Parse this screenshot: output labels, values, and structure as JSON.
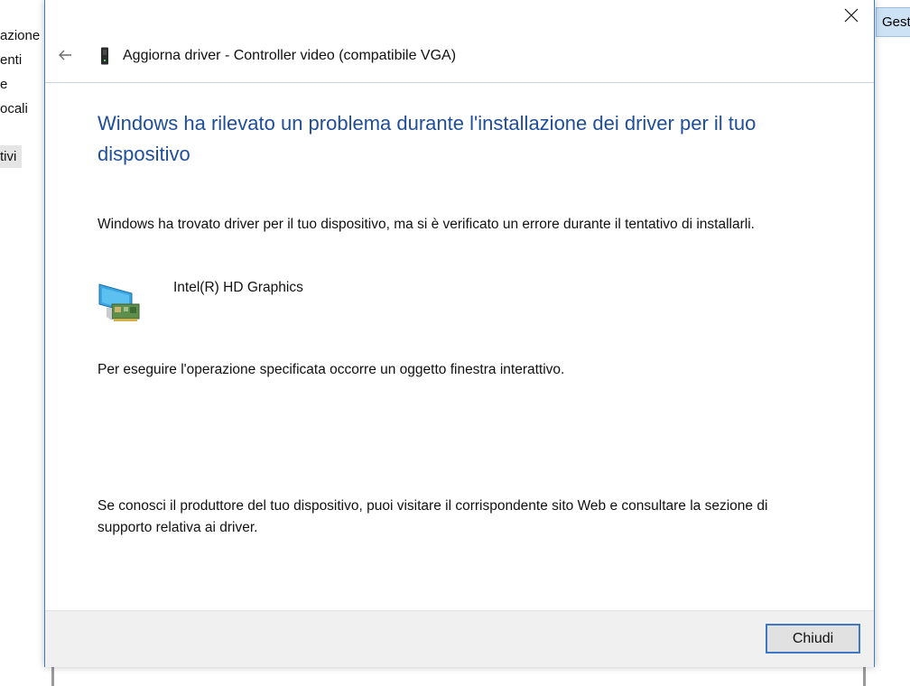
{
  "background": {
    "left_items": [
      "azione",
      "enti",
      "e",
      "ocali",
      "tivi"
    ],
    "right_button_label": "Gest"
  },
  "dialog": {
    "header_title": "Aggiorna driver - Controller video (compatibile VGA)",
    "heading": "Windows ha rilevato un problema durante l'installazione dei driver per il tuo dispositivo",
    "message": "Windows ha trovato driver per il tuo dispositivo, ma si è verificato un errore durante il tentativo di installarli.",
    "device_name": "Intel(R) HD Graphics",
    "error_detail": "Per eseguire l'operazione specificata occorre un oggetto finestra interattivo.",
    "support_note": "Se conosci il produttore del tuo dispositivo, puoi visitare il corrispondente sito Web e consultare la sezione di supporto relativa ai driver.",
    "close_button_label": "Chiudi"
  },
  "icons": {
    "close": "close-icon",
    "back": "back-arrow-icon",
    "device": "device-icon",
    "display_adapter": "display-adapter-icon"
  },
  "colors": {
    "heading": "#1f4e9a",
    "accent_border": "#3c78c3",
    "footer_bg": "#f0f0f0"
  }
}
